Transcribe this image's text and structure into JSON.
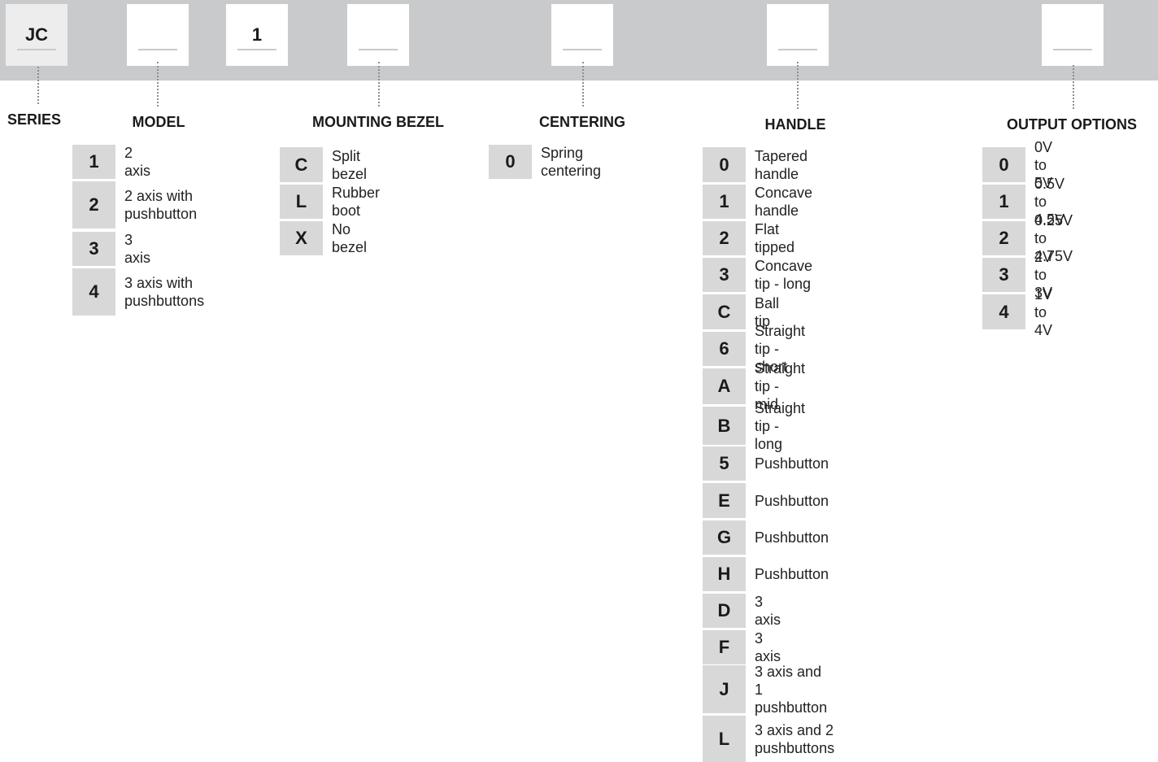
{
  "boxes": [
    {
      "value": "JC",
      "filled": true
    },
    {
      "value": "",
      "filled": false
    },
    {
      "value": "1",
      "filled": false
    },
    {
      "value": "",
      "filled": false
    },
    {
      "value": "",
      "filled": false
    },
    {
      "value": "",
      "filled": false
    },
    {
      "value": "",
      "filled": false
    }
  ],
  "headings": {
    "series": "SERIES",
    "model": "MODEL",
    "mounting_bezel": "MOUNTING BEZEL",
    "centering": "CENTERING",
    "handle": "HANDLE",
    "output_options": "OUTPUT OPTIONS"
  },
  "model": [
    {
      "code": "1",
      "label": "2 axis"
    },
    {
      "code": "2",
      "label": "2 axis with\npushbutton"
    },
    {
      "code": "3",
      "label": "3 axis"
    },
    {
      "code": "4",
      "label": "3 axis with\npushbuttons"
    }
  ],
  "mounting_bezel": [
    {
      "code": "C",
      "label": "Split bezel"
    },
    {
      "code": "L",
      "label": "Rubber boot"
    },
    {
      "code": "X",
      "label": "No bezel"
    }
  ],
  "centering": [
    {
      "code": "0",
      "label": "Spring centering"
    }
  ],
  "handle": [
    {
      "code": "0",
      "label": "Tapered handle"
    },
    {
      "code": "1",
      "label": "Concave handle"
    },
    {
      "code": "2",
      "label": "Flat tipped"
    },
    {
      "code": "3",
      "label": "Concave tip - long"
    },
    {
      "code": "C",
      "label": "Ball tip"
    },
    {
      "code": "6",
      "label": "Straight tip - short"
    },
    {
      "code": "A",
      "label": "Straight tip - mid"
    },
    {
      "code": "B",
      "label": "Straight tip - long"
    },
    {
      "code": "5",
      "label": "Pushbutton"
    },
    {
      "code": "E",
      "label": "Pushbutton"
    },
    {
      "code": "G",
      "label": "Pushbutton"
    },
    {
      "code": "H",
      "label": "Pushbutton"
    },
    {
      "code": "D",
      "label": "3 axis"
    },
    {
      "code": "F",
      "label": "3 axis"
    },
    {
      "code": "J",
      "label": "3 axis and 1\npushbutton"
    },
    {
      "code": "L",
      "label": "3 axis and 2\npushbuttons"
    }
  ],
  "output_options": [
    {
      "code": "0",
      "label": "0V to 5V"
    },
    {
      "code": "1",
      "label": "0.5V to 4.5V"
    },
    {
      "code": "2",
      "label": "0.25V to 4.75V"
    },
    {
      "code": "3",
      "label": "2V to 3V"
    },
    {
      "code": "4",
      "label": "1V to 4V"
    }
  ]
}
